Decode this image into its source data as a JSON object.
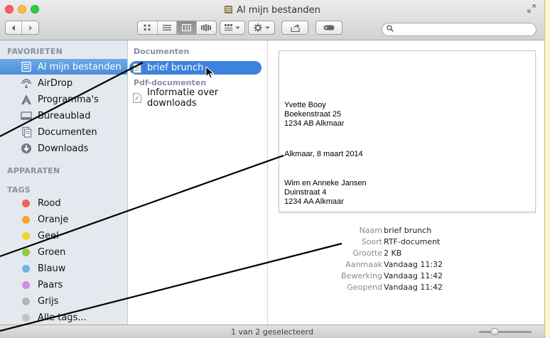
{
  "window": {
    "title": "Al mijn bestanden"
  },
  "toolbar": {
    "back_icon": "chevron-left-icon",
    "forward_icon": "chevron-right-icon",
    "views": [
      "icon-view",
      "list-view",
      "column-view",
      "coverflow-view"
    ],
    "arrange_icon": "arrange-icon",
    "action_icon": "gear-icon",
    "share_icon": "share-icon",
    "tag_icon": "tag-button-icon",
    "search_placeholder": ""
  },
  "sidebar": {
    "favorites_heading": "FAVORIETEN",
    "favorites": [
      {
        "label": "Al mijn bestanden",
        "icon": "all-files-icon",
        "selected": true
      },
      {
        "label": "AirDrop",
        "icon": "airdrop-icon"
      },
      {
        "label": "Programma's",
        "icon": "applications-icon"
      },
      {
        "label": "Bureaublad",
        "icon": "desktop-icon"
      },
      {
        "label": "Documenten",
        "icon": "documents-icon"
      },
      {
        "label": "Downloads",
        "icon": "downloads-icon"
      }
    ],
    "devices_heading": "APPARATEN",
    "tags_heading": "TAGS",
    "tags": [
      {
        "label": "Rood",
        "color": "#f2625e"
      },
      {
        "label": "Oranje",
        "color": "#f9a429"
      },
      {
        "label": "Geel",
        "color": "#f6d425"
      },
      {
        "label": "Groen",
        "color": "#90cd3c"
      },
      {
        "label": "Blauw",
        "color": "#6eb4ee"
      },
      {
        "label": "Paars",
        "color": "#d58de0"
      },
      {
        "label": "Grijs",
        "color": "#b4b4b4"
      },
      {
        "label": "Alle tags...",
        "color": "#c4c4c4"
      }
    ]
  },
  "files": {
    "group1_heading": "Documenten",
    "group1": [
      {
        "name": "brief brunch",
        "selected": true
      }
    ],
    "group2_heading": "Pdf-documenten",
    "group2": [
      {
        "name": "Informatie over downloads"
      }
    ]
  },
  "preview": {
    "sender": [
      "Yvette Booy",
      "Boekenstraat 25",
      "1234 AB Alkmaar"
    ],
    "date_line": "Alkmaar, 8 maart 2014",
    "recipient": [
      "Wim en Anneke Jansen",
      "Duinstraat 4",
      "1234 AA Alkmaar"
    ]
  },
  "info": [
    {
      "key": "Naam",
      "value": "brief brunch"
    },
    {
      "key": "Soort",
      "value": "RTF-document"
    },
    {
      "key": "Grootte",
      "value": "2 KB"
    },
    {
      "key": "Aanmaak",
      "value": "Vandaag 11:32"
    },
    {
      "key": "Bewerking",
      "value": "Vandaag 11:42"
    },
    {
      "key": "Geopend",
      "value": "Vandaag 11:42"
    }
  ],
  "status": {
    "text": "1 van 2 geselecteerd"
  }
}
